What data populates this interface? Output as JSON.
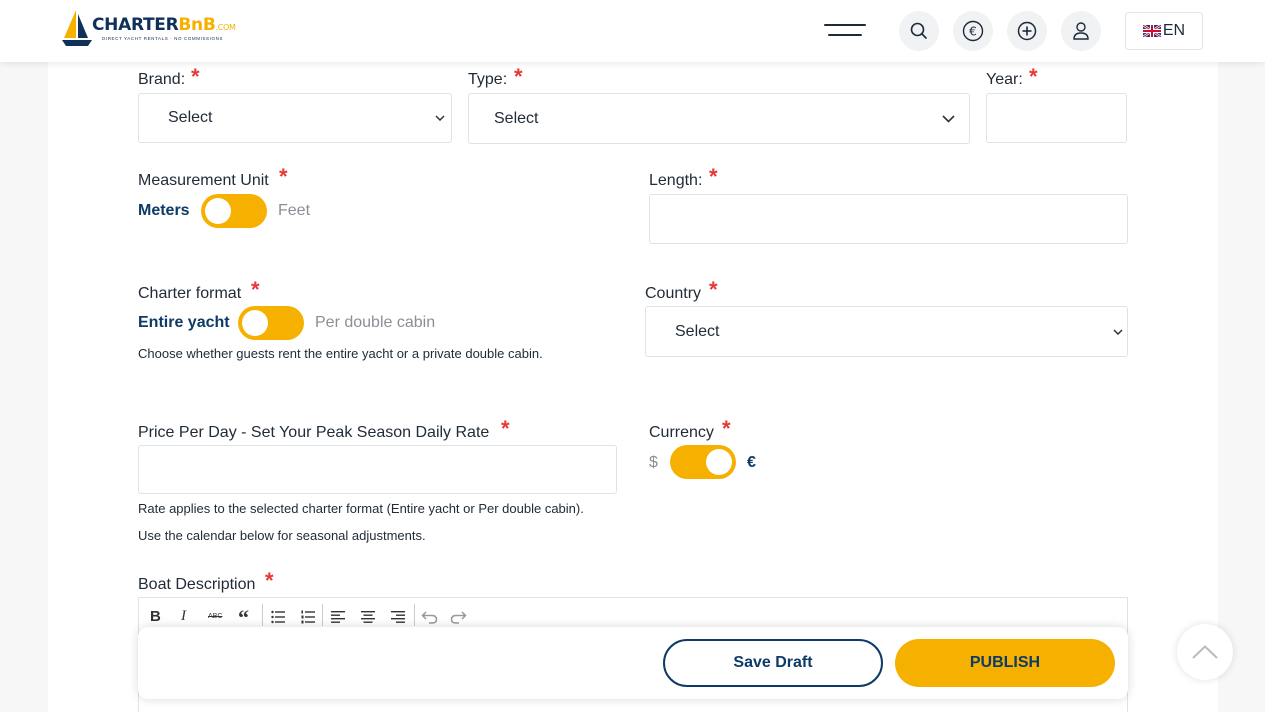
{
  "header": {
    "logo": {
      "part1": "CHARTER",
      "part2": "BnB",
      "suffix": ".COM",
      "tagline": "DIRECT YACHT RENTALS · NO COMMISSIONS"
    },
    "language": "EN",
    "icons": [
      "menu-icon",
      "search-icon",
      "euro-currency-icon",
      "add-icon",
      "user-icon",
      "uk-flag-icon"
    ]
  },
  "form": {
    "brand": {
      "label": "Brand:",
      "value": "Select"
    },
    "type": {
      "label": "Type:",
      "value": "Select"
    },
    "year": {
      "label": "Year:",
      "value": ""
    },
    "measurement": {
      "label": "Measurement Unit",
      "on": "Meters",
      "off": "Feet"
    },
    "length": {
      "label": "Length:",
      "value": ""
    },
    "charter_format": {
      "label": "Charter format",
      "on": "Entire yacht",
      "off": "Per double cabin",
      "help": "Choose whether guests rent the entire yacht or a private double cabin."
    },
    "country": {
      "label": "Country",
      "value": "Select"
    },
    "price": {
      "label": "Price Per Day - Set Your Peak Season Daily Rate",
      "value": "",
      "help1": "Rate applies to the selected charter format (Entire yacht or Per double cabin).",
      "help2": "Use the calendar below for seasonal adjustments."
    },
    "currency": {
      "label": "Currency",
      "off": "$",
      "on": "€"
    },
    "description": {
      "label": "Boat Description"
    },
    "required_mark": "*"
  },
  "editor_toolbar": {
    "bold": "B",
    "italic": "I",
    "strike": "ABC",
    "quote": "“",
    "icons": [
      "bold-icon",
      "italic-icon",
      "strikethrough-icon",
      "quote-icon",
      "bullet-list-icon",
      "numbered-list-icon",
      "align-left-icon",
      "align-center-icon",
      "align-right-icon",
      "undo-icon",
      "redo-icon"
    ]
  },
  "actions": {
    "save_draft": "Save Draft",
    "publish": "PUBLISH"
  },
  "colors": {
    "accent": "#f6b000",
    "navy": "#0d3b66",
    "required": "#e53935"
  }
}
